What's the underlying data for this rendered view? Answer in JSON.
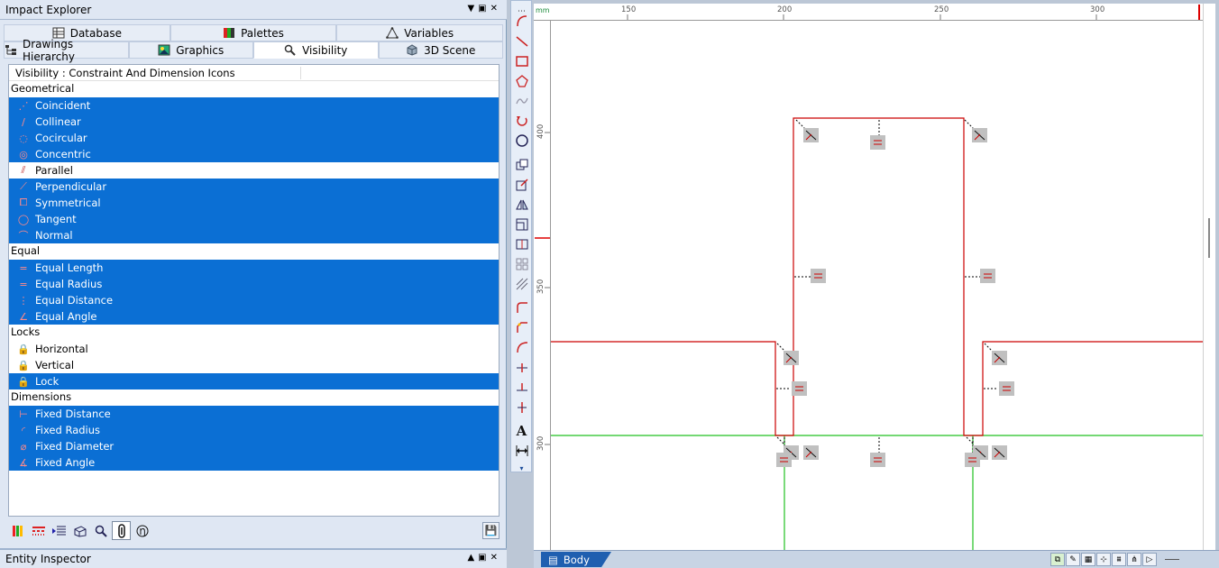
{
  "explorer": {
    "title": "Impact Explorer",
    "tabs_row1": [
      {
        "label": "Database",
        "icon": "database-icon"
      },
      {
        "label": "Palettes",
        "icon": "palettes-icon"
      },
      {
        "label": "Variables",
        "icon": "variables-icon"
      }
    ],
    "tabs_row2": [
      {
        "label": "Drawings Hierarchy",
        "icon": "hierarchy-icon"
      },
      {
        "label": "Graphics",
        "icon": "graphics-icon"
      },
      {
        "label": "Visibility",
        "icon": "visibility-icon",
        "active": true
      },
      {
        "label": "3D Scene",
        "icon": "scene-3d-icon"
      }
    ],
    "list_header": "Visibility : Constraint And Dimension Icons",
    "groups": [
      {
        "label": "Geometrical",
        "items": [
          {
            "label": "Coincident",
            "selected": true,
            "icon": "coincident-icon"
          },
          {
            "label": "Collinear",
            "selected": true,
            "icon": "collinear-icon"
          },
          {
            "label": "Cocircular",
            "selected": true,
            "icon": "cocircular-icon"
          },
          {
            "label": "Concentric",
            "selected": true,
            "icon": "concentric-icon"
          },
          {
            "label": "Parallel",
            "selected": false,
            "icon": "parallel-icon"
          },
          {
            "label": "Perpendicular",
            "selected": true,
            "icon": "perpendicular-icon"
          },
          {
            "label": "Symmetrical",
            "selected": true,
            "icon": "symmetrical-icon"
          },
          {
            "label": "Tangent",
            "selected": true,
            "icon": "tangent-icon"
          },
          {
            "label": "Normal",
            "selected": true,
            "icon": "normal-icon"
          }
        ]
      },
      {
        "label": "Equal",
        "items": [
          {
            "label": "Equal Length",
            "selected": true,
            "icon": "equal-length-icon"
          },
          {
            "label": "Equal Radius",
            "selected": true,
            "icon": "equal-radius-icon"
          },
          {
            "label": "Equal Distance",
            "selected": true,
            "icon": "equal-distance-icon"
          },
          {
            "label": "Equal Angle",
            "selected": true,
            "icon": "equal-angle-icon"
          }
        ]
      },
      {
        "label": "Locks",
        "items": [
          {
            "label": "Horizontal",
            "selected": false,
            "icon": "horizontal-lock-icon"
          },
          {
            "label": "Vertical",
            "selected": false,
            "icon": "vertical-lock-icon"
          },
          {
            "label": "Lock",
            "selected": true,
            "icon": "lock-icon"
          }
        ]
      },
      {
        "label": "Dimensions",
        "items": [
          {
            "label": "Fixed Distance",
            "selected": true,
            "icon": "fixed-distance-icon"
          },
          {
            "label": "Fixed Radius",
            "selected": true,
            "icon": "fixed-radius-icon"
          },
          {
            "label": "Fixed Diameter",
            "selected": true,
            "icon": "fixed-diameter-icon"
          },
          {
            "label": "Fixed Angle",
            "selected": true,
            "icon": "fixed-angle-icon"
          }
        ]
      }
    ]
  },
  "inspector": {
    "title": "Entity Inspector"
  },
  "ruler": {
    "unit": "mm",
    "h_ticks": [
      "150",
      "200",
      "250",
      "300"
    ],
    "v_ticks": [
      "400",
      "350",
      "300"
    ]
  },
  "sheet": {
    "tab_label": "Body"
  },
  "colors": {
    "selection": "#0b6fd4",
    "geometry_line": "#cc0000",
    "axis_line": "#22c022",
    "constraint_badge": "#c0c0c0"
  }
}
